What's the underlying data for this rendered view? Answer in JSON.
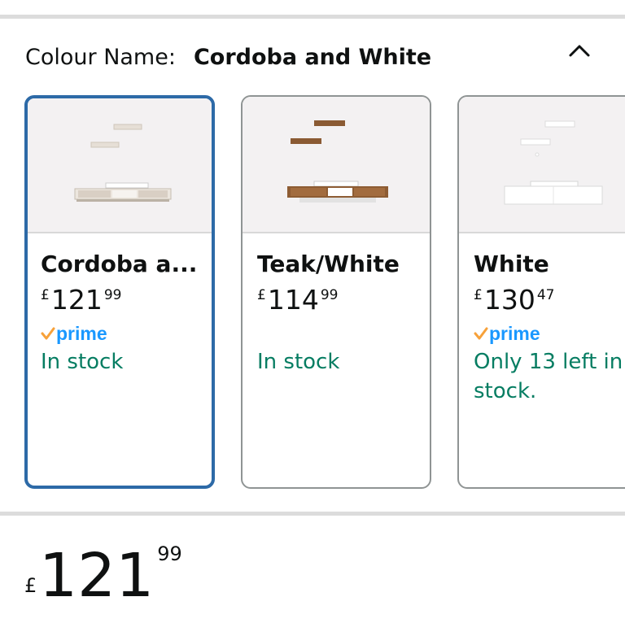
{
  "colour": {
    "label": "Colour Name:",
    "value": "Cordoba and White"
  },
  "swatches": [
    {
      "title": "Cordoba a...",
      "currency": "£",
      "price_whole": "121",
      "price_fraction": "99",
      "prime_label": "prime",
      "stock": "In stock",
      "selected": true
    },
    {
      "title": "Teak/White",
      "currency": "£",
      "price_whole": "114",
      "price_fraction": "99",
      "stock": "In stock",
      "selected": false
    },
    {
      "title": "White",
      "currency": "£",
      "price_whole": "130",
      "price_fraction": "47",
      "prime_label": "prime",
      "stock": "Only 13 left in stock.",
      "selected": false
    }
  ],
  "price": {
    "currency": "£",
    "whole": "121",
    "fraction": "99"
  },
  "icons": {
    "collapse": "chevron-up-icon",
    "prime": "prime-check-icon"
  },
  "colors": {
    "selected_border": "#2d6aa7",
    "stock_green": "#067d62",
    "prime_blue": "#1a98ff",
    "prime_orange": "#f7a13a"
  }
}
